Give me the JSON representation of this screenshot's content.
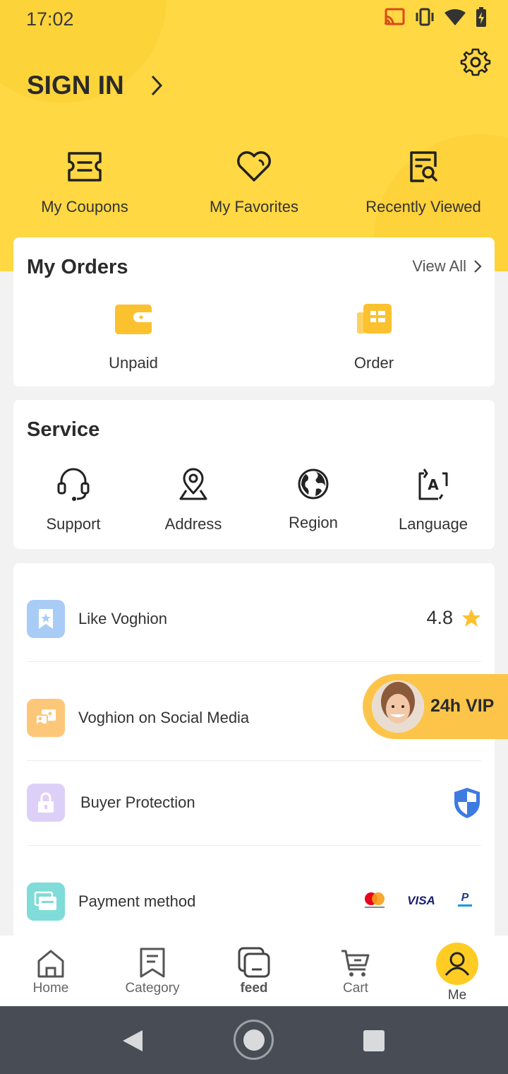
{
  "status": {
    "time": "17:02"
  },
  "header": {
    "sign_in": "SIGN IN"
  },
  "quick_links": [
    {
      "label": "My Coupons",
      "icon": "ticket-icon"
    },
    {
      "label": "My Favorites",
      "icon": "heart-icon"
    },
    {
      "label": "Recently Viewed",
      "icon": "history-icon"
    }
  ],
  "orders": {
    "title": "My Orders",
    "view_all": "View All",
    "items": [
      {
        "label": "Unpaid",
        "icon": "wallet-icon"
      },
      {
        "label": "Order",
        "icon": "order-list-icon"
      }
    ]
  },
  "service": {
    "title": "Service",
    "items": [
      {
        "label": "Support",
        "icon": "headset-icon"
      },
      {
        "label": "Address",
        "icon": "location-pin-icon"
      },
      {
        "label": "Region",
        "icon": "globe-icon"
      },
      {
        "label": "Language",
        "icon": "translate-icon"
      }
    ]
  },
  "list": [
    {
      "label": "Like Voghion",
      "rating": "4.8",
      "icon": "bookmark-star-icon",
      "color": "#a9ccf7"
    },
    {
      "label": "Voghion on Social Media",
      "icon": "social-chat-icon",
      "color": "#fdc77a"
    },
    {
      "label": "Buyer Protection",
      "icon": "lock-icon",
      "color": "#ddd0f8"
    },
    {
      "label": "Payment method",
      "icon": "card-icon",
      "color": "#7fdcd8"
    }
  ],
  "vip": {
    "label": "24h VIP"
  },
  "tabs": [
    {
      "label": "Home",
      "icon": "home-icon"
    },
    {
      "label": "Category",
      "icon": "category-icon"
    },
    {
      "label": "feed",
      "icon": "feed-icon"
    },
    {
      "label": "Cart",
      "icon": "cart-icon"
    },
    {
      "label": "Me",
      "icon": "user-icon"
    }
  ],
  "colors": {
    "brand_yellow": "#ffd843",
    "accent": "#ffcc24"
  }
}
